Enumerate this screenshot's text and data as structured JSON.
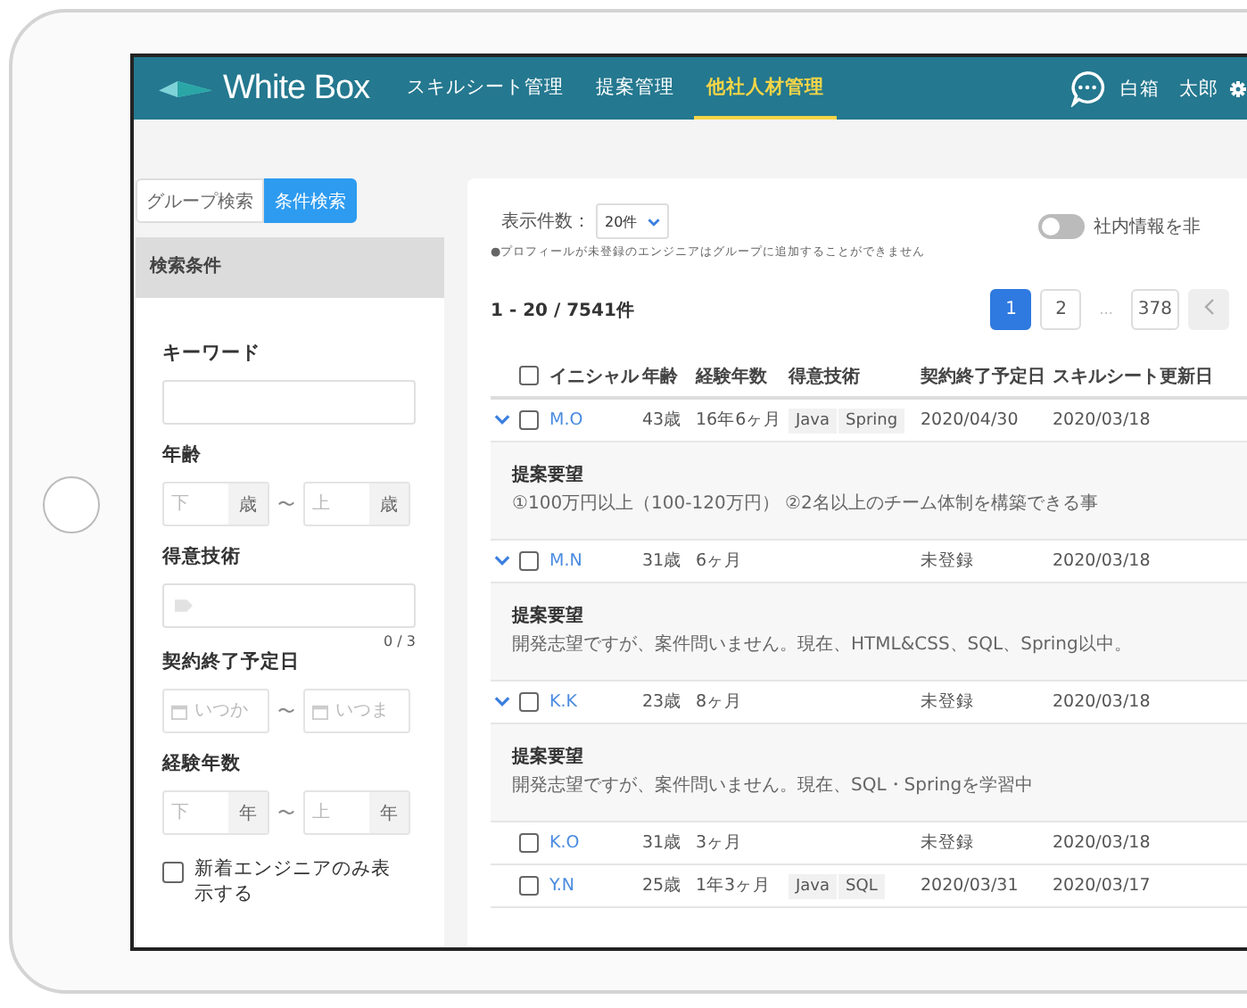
{
  "header": {
    "logo": "White Box",
    "nav": [
      {
        "label": "スキルシート管理",
        "selected": false
      },
      {
        "label": "提案管理",
        "selected": false
      },
      {
        "label": "他社人材管理",
        "selected": true
      }
    ],
    "user": "白箱　太郎"
  },
  "sidebar": {
    "tabs": [
      {
        "label": "グループ検索",
        "selected": false
      },
      {
        "label": "条件検索",
        "selected": true
      }
    ],
    "heading": "検索条件",
    "keyword": {
      "label": "キーワード"
    },
    "age": {
      "label": "年齢",
      "min": {
        "placeholder": "下",
        "unit": "歳"
      },
      "separator": "〜",
      "max": {
        "placeholder": "上",
        "unit": "歳"
      }
    },
    "skills": {
      "label": "得意技術",
      "counter": "0 / 3"
    },
    "contract_end": {
      "label": "契約終了予定日",
      "from": {
        "placeholder": "いつか"
      },
      "separator": "〜",
      "to": {
        "placeholder": "いつま"
      }
    },
    "experience": {
      "label": "経験年数",
      "min": {
        "placeholder": "下",
        "unit": "年"
      },
      "separator": "〜",
      "max": {
        "placeholder": "上",
        "unit": "年"
      }
    },
    "new_only": {
      "label": "新着エンジニアのみ表示する",
      "checked": false
    }
  },
  "results": {
    "page_size": {
      "label": "表示件数：",
      "value": "20件"
    },
    "hide_internal": {
      "label": "社内情報を非",
      "on": false
    },
    "note": "●プロフィールが未登録のエンジニアはグループに追加することができません",
    "count": "1 - 20 / 7541件",
    "pages": [
      {
        "label": "1",
        "kind": "page",
        "selected": true
      },
      {
        "label": "2",
        "kind": "page",
        "selected": false
      },
      {
        "label": "...",
        "kind": "gap",
        "selected": false
      },
      {
        "label": "378",
        "kind": "page",
        "selected": false
      }
    ],
    "table": {
      "select_all": {
        "checked": false
      },
      "columns": [
        "イニシャル",
        "年齢",
        "経験年数",
        "得意技術",
        "契約終了予定日",
        "スキルシート更新日"
      ],
      "rows": [
        {
          "checked": false,
          "initials": "M.O",
          "age": "43歳",
          "experience": "16年6ヶ月",
          "skills": [
            "Java",
            "Spring"
          ],
          "contract_end": "2020/04/30",
          "updated": "2020/03/18",
          "request": {
            "title": "提案要望",
            "text": "①100万円以上（100-120万円） ②2名以上のチーム体制を構築できる事"
          }
        },
        {
          "checked": false,
          "initials": "M.N",
          "age": "31歳",
          "experience": "6ヶ月",
          "skills": [],
          "contract_end": "未登録",
          "updated": "2020/03/18",
          "request": {
            "title": "提案要望",
            "text": "開発志望ですが、案件問いません。現在、HTML&CSS、SQL、Spring以中。"
          }
        },
        {
          "checked": false,
          "initials": "K.K",
          "age": "23歳",
          "experience": "8ヶ月",
          "skills": [],
          "contract_end": "未登録",
          "updated": "2020/03/18",
          "request": {
            "title": "提案要望",
            "text": "開発志望ですが、案件問いません。現在、SQL・Springを学習中"
          }
        },
        {
          "checked": false,
          "initials": "K.O",
          "age": "31歳",
          "experience": "3ヶ月",
          "skills": [],
          "contract_end": "未登録",
          "updated": "2020/03/18"
        },
        {
          "checked": false,
          "initials": "Y.N",
          "age": "25歳",
          "experience": "1年3ヶ月",
          "skills": [
            "Java",
            "SQL"
          ],
          "contract_end": "2020/03/31",
          "updated": "2020/03/17"
        }
      ]
    }
  }
}
